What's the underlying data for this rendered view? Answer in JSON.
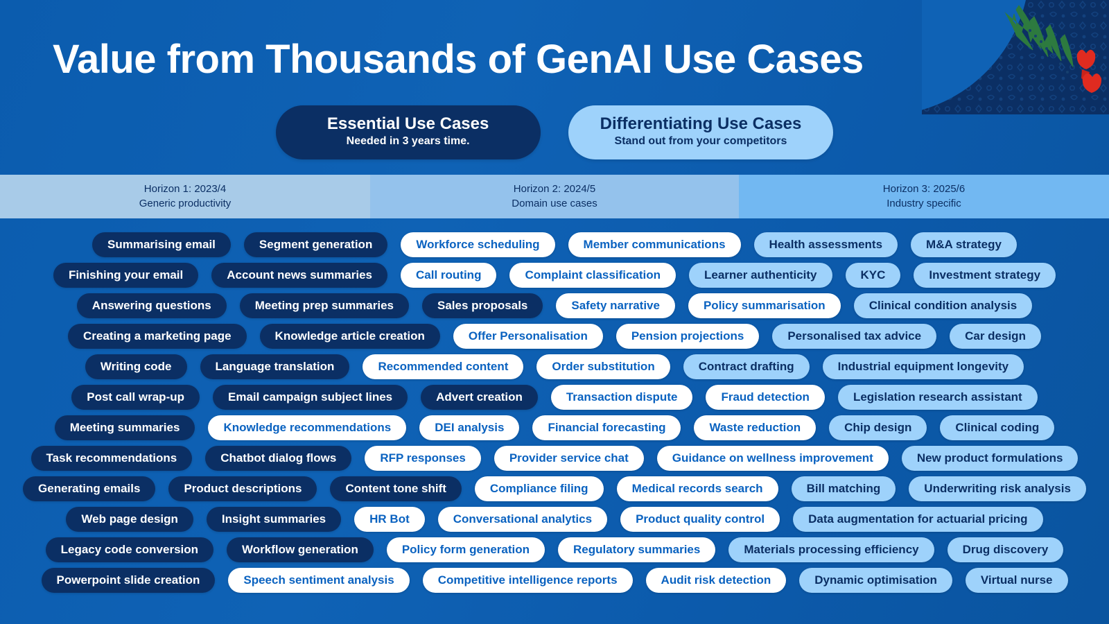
{
  "header": {
    "title": "Value from Thousands of GenAI Use Cases",
    "legend": [
      {
        "key": "essential",
        "title": "Essential Use Cases",
        "subtitle": "Needed in 3 years time.",
        "style": "navy",
        "bg_color": "#0b2f64",
        "text_color": "#ffffff"
      },
      {
        "key": "differentiating",
        "title": "Differentiating Use Cases",
        "subtitle": "Stand out from your competitors",
        "style": "lightblue",
        "bg_color": "#9ed2fb",
        "text_color": "#0b2f64"
      }
    ]
  },
  "horizons": [
    {
      "line1": "Horizon 1: 2023/4",
      "line2": "Generic productivity",
      "bg_color": "#a8cbe8"
    },
    {
      "line1": "Horizon 2: 2024/5",
      "line2": "Domain use cases",
      "bg_color": "#94c2ec"
    },
    {
      "line1": "Horizon 3: 2025/6",
      "line2": "Industry specific",
      "bg_color": "#72b8f2"
    }
  ],
  "palette": {
    "background_blue": "#0b5cae",
    "pill_navy": "#0b2f64",
    "pill_white": "#ffffff",
    "pill_white_text": "#0a62c0",
    "pill_lightblue": "#9ed2fb"
  },
  "use_case_rows": [
    [
      {
        "label": "Summarising email",
        "style": "navy"
      },
      {
        "label": "Segment generation",
        "style": "navy"
      },
      {
        "label": "Workforce scheduling",
        "style": "white"
      },
      {
        "label": "Member communications",
        "style": "white"
      },
      {
        "label": "Health assessments",
        "style": "lightblue"
      },
      {
        "label": "M&A strategy",
        "style": "lightblue"
      }
    ],
    [
      {
        "label": "Finishing your email",
        "style": "navy"
      },
      {
        "label": "Account news summaries",
        "style": "navy"
      },
      {
        "label": "Call routing",
        "style": "white"
      },
      {
        "label": "Complaint classification",
        "style": "white"
      },
      {
        "label": "Learner authenticity",
        "style": "lightblue"
      },
      {
        "label": "KYC",
        "style": "lightblue"
      },
      {
        "label": "Investment strategy",
        "style": "lightblue"
      }
    ],
    [
      {
        "label": "Answering questions",
        "style": "navy"
      },
      {
        "label": "Meeting prep summaries",
        "style": "navy"
      },
      {
        "label": "Sales proposals",
        "style": "navy"
      },
      {
        "label": "Safety narrative",
        "style": "white"
      },
      {
        "label": "Policy summarisation",
        "style": "white"
      },
      {
        "label": "Clinical condition analysis",
        "style": "lightblue"
      }
    ],
    [
      {
        "label": "Creating a marketing page",
        "style": "navy"
      },
      {
        "label": "Knowledge article creation",
        "style": "navy"
      },
      {
        "label": "Offer Personalisation",
        "style": "white"
      },
      {
        "label": "Pension projections",
        "style": "white"
      },
      {
        "label": "Personalised tax advice",
        "style": "lightblue"
      },
      {
        "label": "Car design",
        "style": "lightblue"
      }
    ],
    [
      {
        "label": "Writing code",
        "style": "navy"
      },
      {
        "label": "Language translation",
        "style": "navy"
      },
      {
        "label": "Recommended content",
        "style": "white"
      },
      {
        "label": "Order substitution",
        "style": "white"
      },
      {
        "label": "Contract drafting",
        "style": "lightblue"
      },
      {
        "label": "Industrial equipment longevity",
        "style": "lightblue"
      }
    ],
    [
      {
        "label": "Post call wrap-up",
        "style": "navy"
      },
      {
        "label": "Email campaign subject lines",
        "style": "navy"
      },
      {
        "label": "Advert creation",
        "style": "navy"
      },
      {
        "label": "Transaction dispute",
        "style": "white"
      },
      {
        "label": "Fraud detection",
        "style": "white"
      },
      {
        "label": "Legislation research assistant",
        "style": "lightblue"
      }
    ],
    [
      {
        "label": "Meeting summaries",
        "style": "navy"
      },
      {
        "label": "Knowledge recommendations",
        "style": "white"
      },
      {
        "label": "DEI analysis",
        "style": "white"
      },
      {
        "label": "Financial forecasting",
        "style": "white"
      },
      {
        "label": "Waste reduction",
        "style": "white"
      },
      {
        "label": "Chip design",
        "style": "lightblue"
      },
      {
        "label": "Clinical coding",
        "style": "lightblue"
      }
    ],
    [
      {
        "label": "Task recommendations",
        "style": "navy"
      },
      {
        "label": "Chatbot dialog flows",
        "style": "navy"
      },
      {
        "label": "RFP responses",
        "style": "white"
      },
      {
        "label": "Provider service chat",
        "style": "white"
      },
      {
        "label": "Guidance on wellness improvement",
        "style": "white"
      },
      {
        "label": "New product formulations",
        "style": "lightblue"
      }
    ],
    [
      {
        "label": "Generating emails",
        "style": "navy"
      },
      {
        "label": "Product descriptions",
        "style": "navy"
      },
      {
        "label": "Content tone shift",
        "style": "navy"
      },
      {
        "label": "Compliance filing",
        "style": "white"
      },
      {
        "label": "Medical records search",
        "style": "white"
      },
      {
        "label": "Bill matching",
        "style": "lightblue"
      },
      {
        "label": "Underwriting risk analysis",
        "style": "lightblue"
      }
    ],
    [
      {
        "label": "Web page design",
        "style": "navy"
      },
      {
        "label": "Insight summaries",
        "style": "navy"
      },
      {
        "label": "HR Bot",
        "style": "white"
      },
      {
        "label": "Conversational analytics",
        "style": "white"
      },
      {
        "label": "Product quality control",
        "style": "white"
      },
      {
        "label": "Data augmentation for actuarial pricing",
        "style": "lightblue"
      }
    ],
    [
      {
        "label": "Legacy code conversion",
        "style": "navy"
      },
      {
        "label": "Workflow generation",
        "style": "navy"
      },
      {
        "label": "Policy form generation",
        "style": "white"
      },
      {
        "label": "Regulatory summaries",
        "style": "white"
      },
      {
        "label": "Materials processing efficiency",
        "style": "lightblue"
      },
      {
        "label": "Drug discovery",
        "style": "lightblue"
      }
    ],
    [
      {
        "label": "Powerpoint slide creation",
        "style": "navy"
      },
      {
        "label": "Speech sentiment analysis",
        "style": "white"
      },
      {
        "label": "Competitive intelligence reports",
        "style": "white"
      },
      {
        "label": "Audit risk detection",
        "style": "white"
      },
      {
        "label": "Dynamic optimisation",
        "style": "lightblue"
      },
      {
        "label": "Virtual nurse",
        "style": "lightblue"
      }
    ]
  ]
}
